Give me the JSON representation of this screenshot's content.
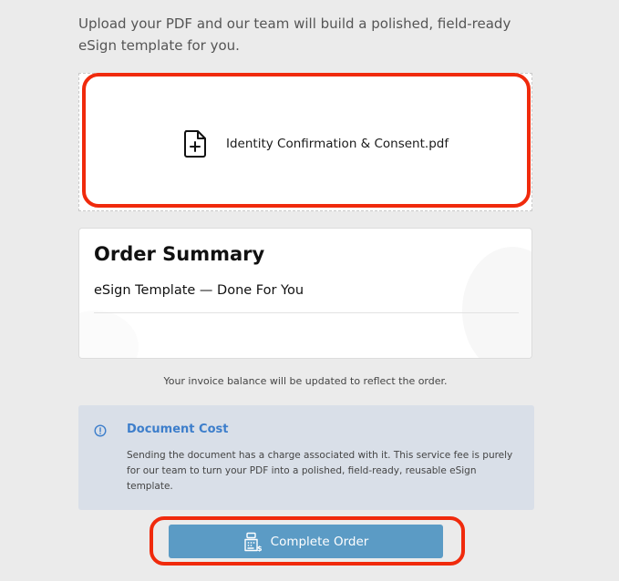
{
  "intro": {
    "text": "Upload your PDF and our team will build a polished, field-ready eSign template for you."
  },
  "upload": {
    "file_icon": "file-plus-icon",
    "file_name": "Identity Confirmation & Consent.pdf"
  },
  "summary": {
    "title": "Order Summary",
    "item": "eSign Template — Done For You"
  },
  "invoice_note": "Your invoice balance will be updated to reflect the order.",
  "notice": {
    "icon": "info-circle-icon",
    "title": "Document Cost",
    "body": "Sending the document has a charge associated with it. This service fee is purely for our team to turn your PDF into a polished, field-ready, reusable eSign template."
  },
  "cta": {
    "icon": "cash-register-icon",
    "label": "Complete Order"
  },
  "colors": {
    "accent": "#5b9bc5",
    "notice_title": "#3d7ecb",
    "highlight": "#f02a0c"
  }
}
